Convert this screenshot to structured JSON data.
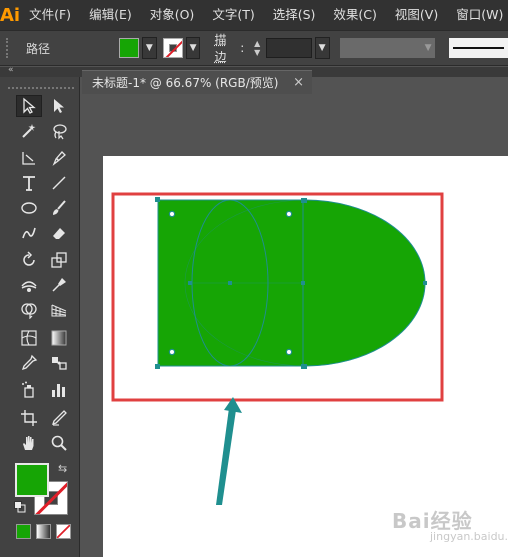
{
  "app": {
    "logo": "Ai"
  },
  "menu": [
    "文件(F)",
    "编辑(E)",
    "对象(O)",
    "文字(T)",
    "选择(S)",
    "效果(C)",
    "视图(V)",
    "窗口(W)"
  ],
  "control_bar": {
    "selection_type": "路径",
    "stroke_label": "描边",
    "stroke_colon": ":",
    "fill_color": "#16a505"
  },
  "document_tab": {
    "title": "未标题-1* @ 66.67% (RGB/预览)",
    "close": "×"
  },
  "panel_collapse": "«",
  "toolbar": {
    "tools": [
      "selection-tool",
      "direct-selection-tool",
      "magic-wand-tool",
      "lasso-tool",
      "pen-tool",
      "curvature-tool",
      "type-tool",
      "line-segment-tool",
      "ellipse-tool",
      "paintbrush-tool",
      "shaper-tool",
      "eraser-tool",
      "rotate-tool",
      "scale-tool",
      "width-tool",
      "puppet-warp-tool",
      "shape-builder-tool",
      "perspective-grid-tool",
      "mesh-tool",
      "gradient-tool",
      "eyedropper-tool",
      "blend-tool",
      "symbol-sprayer-tool",
      "column-graph-tool",
      "artboard-tool",
      "slice-tool",
      "hand-tool",
      "zoom-tool"
    ],
    "fill_color": "#16a505",
    "swap_arrow": "⇆"
  },
  "canvas": {
    "shape_fill": "#16a505",
    "highlight_color": "#e04040",
    "arrow_color": "#1f8f8f"
  },
  "watermark": {
    "main": "Bai经验",
    "sub": "jingyan.baidu.com"
  }
}
